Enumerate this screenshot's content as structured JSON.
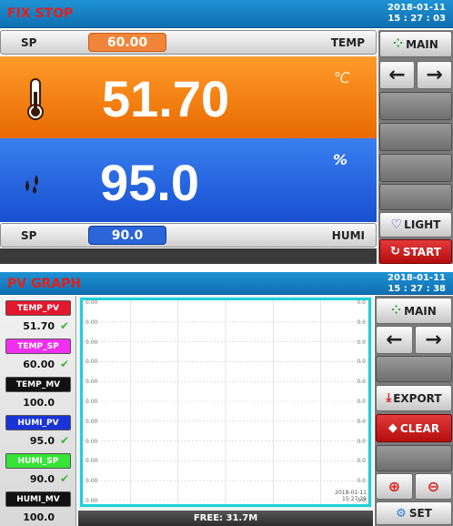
{
  "screen1": {
    "title": "FIX STOP",
    "date": "2018-01-11",
    "time": "15 : 27 : 03",
    "temp": {
      "sp_label": "SP",
      "sp_value": "60.00",
      "name": "TEMP",
      "pv": "51.70",
      "unit": "℃",
      "icon": "thermometer-icon"
    },
    "humi": {
      "sp_label": "SP",
      "sp_value": "90.0",
      "name": "HUMI",
      "pv": "95.0",
      "unit": "%",
      "icon": "water-drops-icon"
    },
    "side": {
      "main_label": "MAIN",
      "light_label": "LIGHT",
      "start_label": "START"
    }
  },
  "screen2": {
    "title": "PV GRAPH",
    "date": "2018-01-11",
    "time": "15 : 27 : 38",
    "legend": [
      {
        "label": "TEMP_PV",
        "value": "51.70",
        "color": "#e3182d"
      },
      {
        "label": "TEMP_SP",
        "value": "60.00",
        "color": "#f02ff0"
      },
      {
        "label": "TEMP_MV",
        "value": "100.0",
        "color": "#111111"
      },
      {
        "label": "HUMI_PV",
        "value": "95.0",
        "color": "#1a33d6"
      },
      {
        "label": "HUMI_SP",
        "value": "90.0",
        "color": "#36e336"
      },
      {
        "label": "HUMI_MV",
        "value": "100.0",
        "color": "#111111"
      }
    ],
    "graph": {
      "y_tick_labels": [
        "0.00",
        "0.00",
        "0.00",
        "0.00",
        "0.00",
        "0.00",
        "0.00",
        "0.00",
        "0.00",
        "0.00",
        "0.00"
      ],
      "right_tick_labels": [
        "0.0",
        "0.0",
        "0.0",
        "0.0",
        "0.0",
        "0.0",
        "0.0",
        "0.0",
        "0.0",
        "0.0",
        "0.0"
      ],
      "x_end_date": "2018-01-11",
      "x_end_time": "15:27:29"
    },
    "free_label": "FREE: 31.7M",
    "side": {
      "main_label": "MAIN",
      "export_label": "EXPORT",
      "clear_label": "CLEAR",
      "set_label": "SET"
    }
  },
  "colors": {
    "temp_band": "#f07a10",
    "humi_band": "#1f66e6",
    "title_red": "#e0201c",
    "sp_temp_box": "#f08a30",
    "sp_humi_box": "#2a66d8"
  }
}
